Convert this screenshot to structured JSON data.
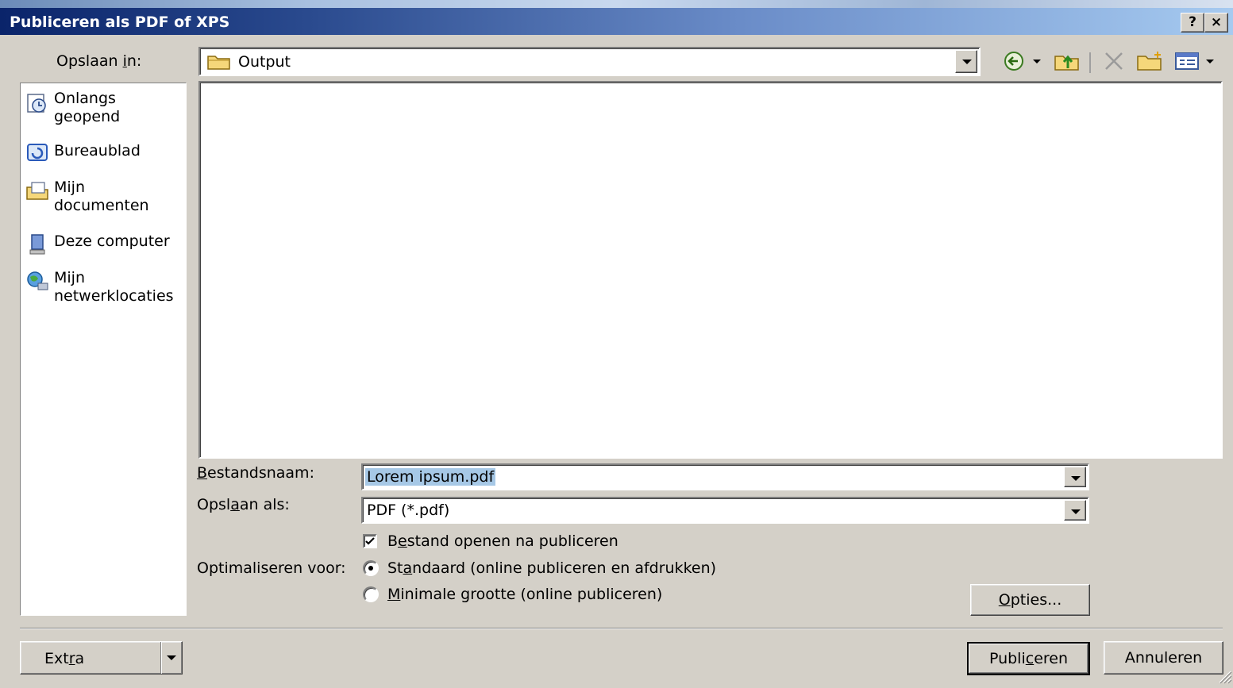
{
  "dialog": {
    "title": "Publiceren als PDF of XPS",
    "help_button": "?",
    "close_button": "×"
  },
  "location": {
    "label_pre": "Opslaan ",
    "label_accel": "i",
    "label_post": "n:",
    "current_folder": "Output"
  },
  "toolbar": {
    "icons": [
      "back-icon",
      "dropdown-arrow-icon",
      "up-folder-icon",
      "delete-icon",
      "new-folder-icon",
      "views-menu-icon"
    ]
  },
  "places": [
    {
      "label": "Onlangs geopend",
      "line1": "Onlangs",
      "line2": "geopend",
      "icon": "recent-documents-icon"
    },
    {
      "label": "Bureaublad",
      "line1": "Bureaublad",
      "line2": "",
      "icon": "desktop-icon"
    },
    {
      "label": "Mijn documenten",
      "line1": "Mijn",
      "line2": "documenten",
      "icon": "my-documents-icon"
    },
    {
      "label": "Deze computer",
      "line1": "Deze computer",
      "line2": "",
      "icon": "my-computer-icon"
    },
    {
      "label": "Mijn netwerklocaties",
      "line1": "Mijn",
      "line2": "netwerklocaties",
      "icon": "network-places-icon"
    }
  ],
  "filename": {
    "label_accel": "B",
    "label_post": "estandsnaam:",
    "value": "Lorem ipsum.pdf"
  },
  "save_as_type": {
    "label_pre": "Opsl",
    "label_accel": "a",
    "label_post": "an als:",
    "value": "PDF (*.pdf)"
  },
  "open_after": {
    "checked": true,
    "label_pre": "B",
    "label_accel": "e",
    "label_post": "stand openen na publiceren"
  },
  "optimize": {
    "label": "Optimaliseren voor:",
    "options": [
      {
        "pre": "St",
        "accel": "a",
        "post": "ndaard (online publiceren en afdrukken)",
        "selected": true
      },
      {
        "pre": "",
        "accel": "M",
        "post": "inimale grootte (online publiceren)",
        "selected": false
      }
    ]
  },
  "buttons": {
    "options_accel": "O",
    "options_post": "pties...",
    "extra_pre": "Ext",
    "extra_accel": "r",
    "extra_post": "a",
    "publish_pre": "Publi",
    "publish_accel": "c",
    "publish_post": "eren",
    "cancel": "Annuleren"
  },
  "colors": {
    "title_start": "#0a246a",
    "title_end": "#a6caf0",
    "face": "#d4d0c8",
    "selection": "#a6c8e6"
  }
}
